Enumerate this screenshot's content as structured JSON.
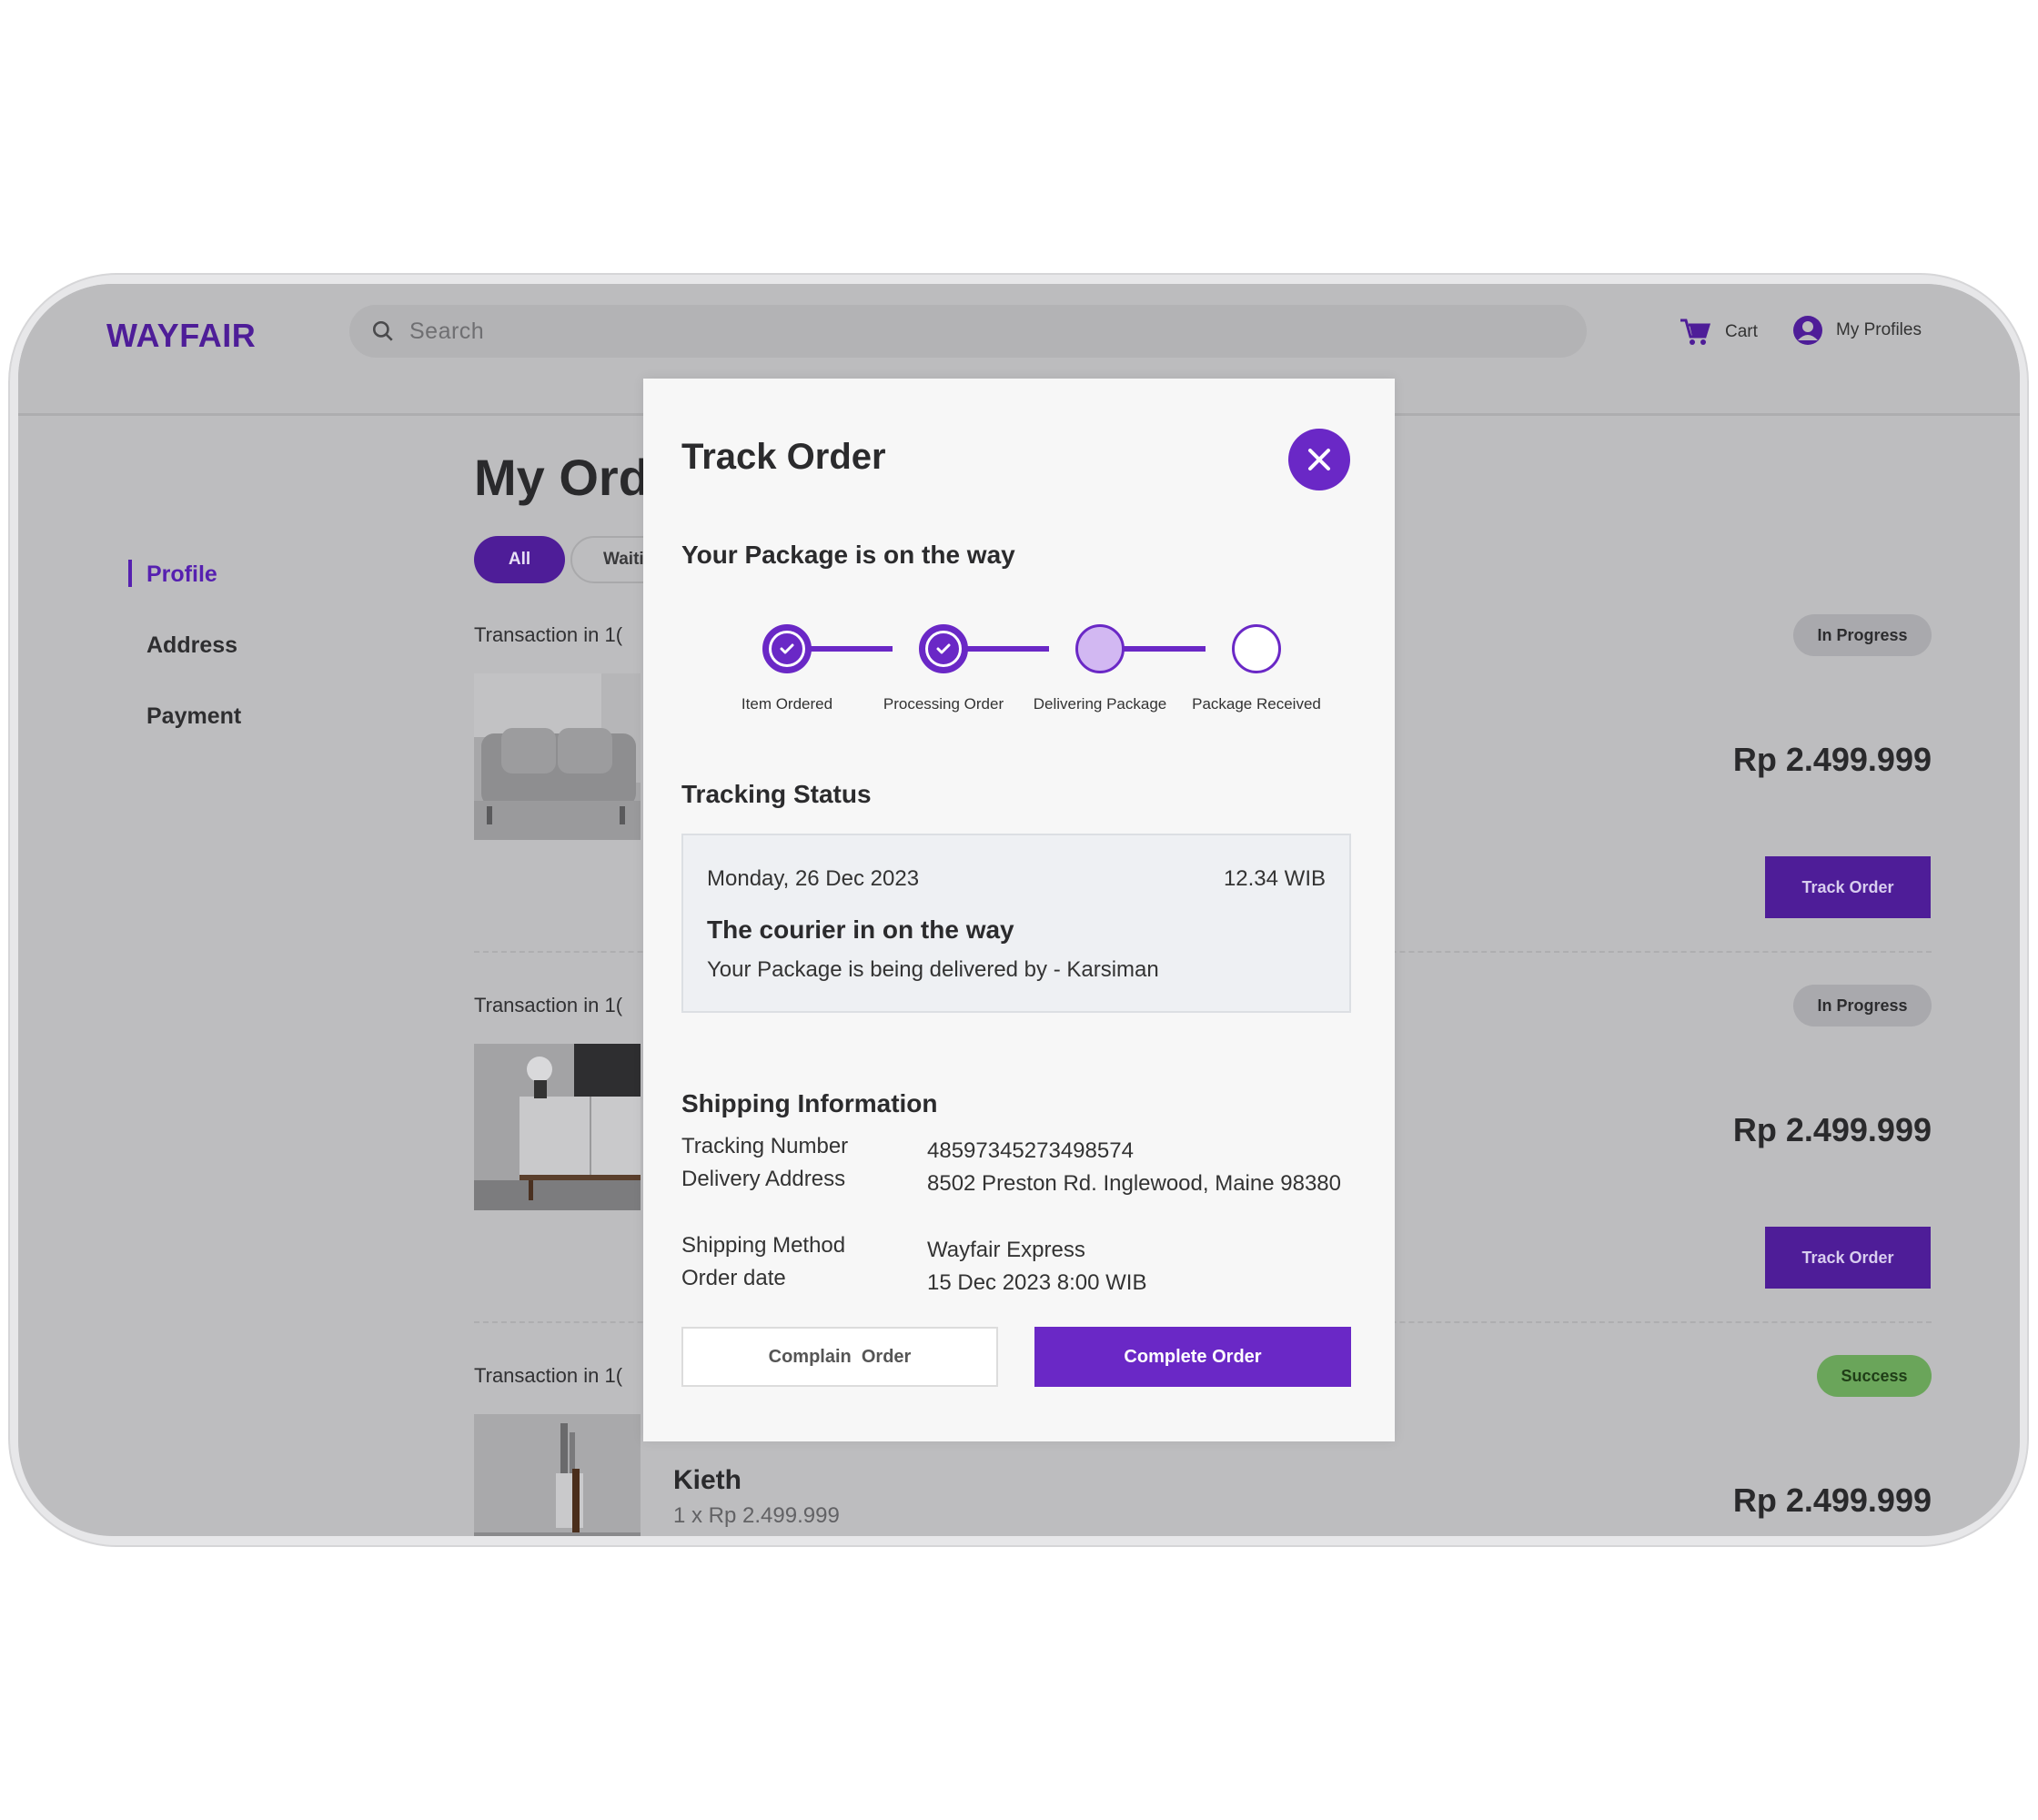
{
  "app": {
    "logo": "WAYFAIR",
    "search_placeholder": "Search",
    "cart_label": "Cart",
    "profile_label": "My Profiles"
  },
  "sidebar": {
    "items": [
      {
        "label": "Profile",
        "active": true
      },
      {
        "label": "Address",
        "active": false
      },
      {
        "label": "Payment",
        "active": false
      }
    ]
  },
  "main": {
    "title": "My Ord",
    "tabs": [
      {
        "label": "All",
        "active": true
      },
      {
        "label": "Waiti",
        "active": false
      }
    ],
    "orders": [
      {
        "transaction_label": "Transaction in  1(",
        "status": "In Progress",
        "price": "Rp 2.499.999",
        "track_label": "Track Order"
      },
      {
        "transaction_label": "Transaction in  1(",
        "status": "In Progress",
        "price": "Rp 2.499.999",
        "track_label": "Track Order"
      },
      {
        "transaction_label": "Transaction in  1(",
        "status": "Success",
        "price": "Rp 2.499.999",
        "product_name": "Kieth",
        "product_qty": "1 x Rp 2.499.999"
      }
    ]
  },
  "modal": {
    "title": "Track Order",
    "subtitle": "Your Package is on the way",
    "steps": [
      {
        "label": "Item Ordered",
        "state": "done"
      },
      {
        "label": "Processing Order",
        "state": "done"
      },
      {
        "label": "Delivering Package",
        "state": "active"
      },
      {
        "label": "Package Received",
        "state": "todo"
      }
    ],
    "tracking_status_heading": "Tracking Status",
    "tracking": {
      "date": "Monday, 26 Dec 2023",
      "time": "12.34 WIB",
      "headline": "The courier in on the way",
      "detail": "Your Package is being delivered by - Karsiman"
    },
    "shipping_heading": "Shipping Information",
    "shipping": [
      {
        "label": "Tracking Number",
        "value": "48597345273498574"
      },
      {
        "label": "Delivery Address",
        "value": "8502 Preston Rd. Inglewood, Maine 98380"
      },
      {
        "label": "Shipping Method",
        "value": "Wayfair Express"
      },
      {
        "label": "Order date",
        "value": "15 Dec 2023 8:00 WIB"
      }
    ],
    "complain_label": "Complain  Order",
    "complete_label": "Complete Order"
  },
  "colors": {
    "brand": "#4e1d98",
    "accent": "#6a28c6",
    "success": "#6aa55a",
    "overlay": "#bdbdbf"
  }
}
